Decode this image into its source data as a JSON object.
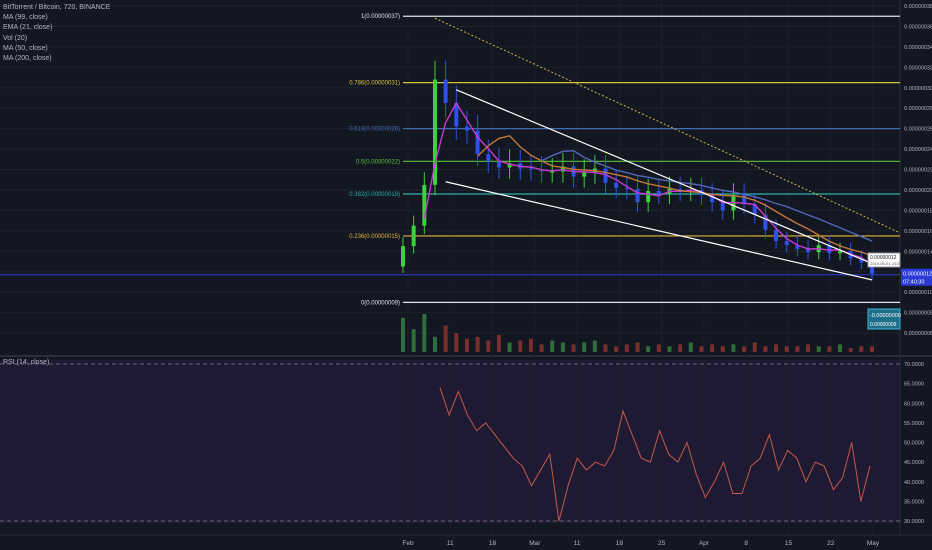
{
  "header": {
    "symbol_line": "BitTorrent / Bitcoin, 720, BINANCE",
    "indicators": [
      "MA (99, close)",
      "EMA (21, close)",
      "Vol (20)",
      "MA (50, close)",
      "MA (200, close)"
    ]
  },
  "rsi_label": "RSI (14, close)",
  "colors": {
    "background": "#131722",
    "rsi_background": "#1f1a33",
    "candle_up": "#3bd23b",
    "candle_down": "#2d51f0",
    "ema21": "#c73ad1",
    "ma50": "#c5763a",
    "ma99": "#5267b8",
    "trendline": "#ffffff",
    "rsi_line": "#c4584a",
    "current_price_line": "#2a3ad6"
  },
  "chart_data": [
    {
      "type": "candlestick",
      "title": "BitTorrent / Bitcoin, 720, BINANCE",
      "y_axis": {
        "range": [
          5e-08,
          3.9e-07
        ],
        "ticks": [
          "0.00000006",
          "0.00000008",
          "0.00000010",
          "0.00000012",
          "0.00000014",
          "0.00000016",
          "0.00000018",
          "0.00000020",
          "0.00000022",
          "0.00000024",
          "0.00000026",
          "0.00000028",
          "0.00000030",
          "0.00000032",
          "0.00000034",
          "0.00000036",
          "0.00000038"
        ]
      },
      "x_axis": {
        "ticks": [
          "Feb",
          "11",
          "18",
          "Mar",
          "11",
          "18",
          "25",
          "Apr",
          "8",
          "15",
          "22",
          "May"
        ]
      },
      "close_series": [
        1.45e-07,
        1.65e-07,
        2.05e-07,
        3.08e-07,
        2.85e-07,
        2.62e-07,
        2.58e-07,
        2.35e-07,
        2.28e-07,
        2.22e-07,
        2.26e-07,
        2.21e-07,
        2.2e-07,
        2.18e-07,
        2.18e-07,
        2.23e-07,
        2.13e-07,
        2.17e-07,
        2.21e-07,
        2.07e-07,
        2.02e-07,
        2.01e-07,
        1.88e-07,
        1.99e-07,
        1.96e-07,
        2.01e-07,
        1.99e-07,
        2e-07,
        1.95e-07,
        1.88e-07,
        1.8e-07,
        1.95e-07,
        1.86e-07,
        1.76e-07,
        1.61e-07,
        1.5e-07,
        1.46e-07,
        1.42e-07,
        1.39e-07,
        1.46e-07,
        1.38e-07,
        1.4e-07,
        1.33e-07,
        1.29e-07,
        1.18e-07
      ],
      "fibonacci_levels": [
        {
          "label": "1(0.00000037)",
          "value": 3.7e-07,
          "color": "#e0e3eb"
        },
        {
          "label": "0.786(0.00000031)",
          "value": 3.05e-07,
          "color": "#d9c43a"
        },
        {
          "label": "0.618(0.00000026)",
          "value": 2.6e-07,
          "color": "#3f6eb0"
        },
        {
          "label": "0.5(0.00000022)",
          "value": 2.28e-07,
          "color": "#54c23a"
        },
        {
          "label": "0.382(0.00000019)",
          "value": 1.96e-07,
          "color": "#2bb3a7"
        },
        {
          "label": "0.236(0.00000015)",
          "value": 1.55e-07,
          "color": "#e0b53a"
        },
        {
          "label": "0(0.00000009)",
          "value": 9e-08,
          "color": "#e0e3eb"
        }
      ],
      "current_price": {
        "label": "0.00000012",
        "time_label": "07:40:30"
      },
      "tooltip": {
        "label": "0.00000012",
        "date": "2019-05-01 23:00"
      },
      "measure_box": {
        "line1": "-0.00000000",
        "line2": "0.00000009"
      }
    },
    {
      "type": "line",
      "title": "RSI (14, close)",
      "y_axis": {
        "range": [
          28,
          72
        ],
        "ticks": [
          "30.0000",
          "35.0000",
          "40.0000",
          "45.0000",
          "50.0000",
          "55.0000",
          "60.0000",
          "65.0000",
          "70.0000"
        ]
      },
      "values": [
        64,
        57,
        63,
        57,
        53,
        55,
        52,
        49,
        46,
        44,
        39,
        43,
        47,
        30,
        39,
        46,
        43,
        45,
        44,
        48,
        58,
        52,
        46,
        45,
        53,
        47,
        45,
        50,
        42,
        36,
        40,
        45,
        37,
        37,
        44,
        46,
        52,
        43,
        48,
        46,
        40,
        45,
        44,
        38,
        41,
        50,
        35,
        44
      ]
    }
  ]
}
